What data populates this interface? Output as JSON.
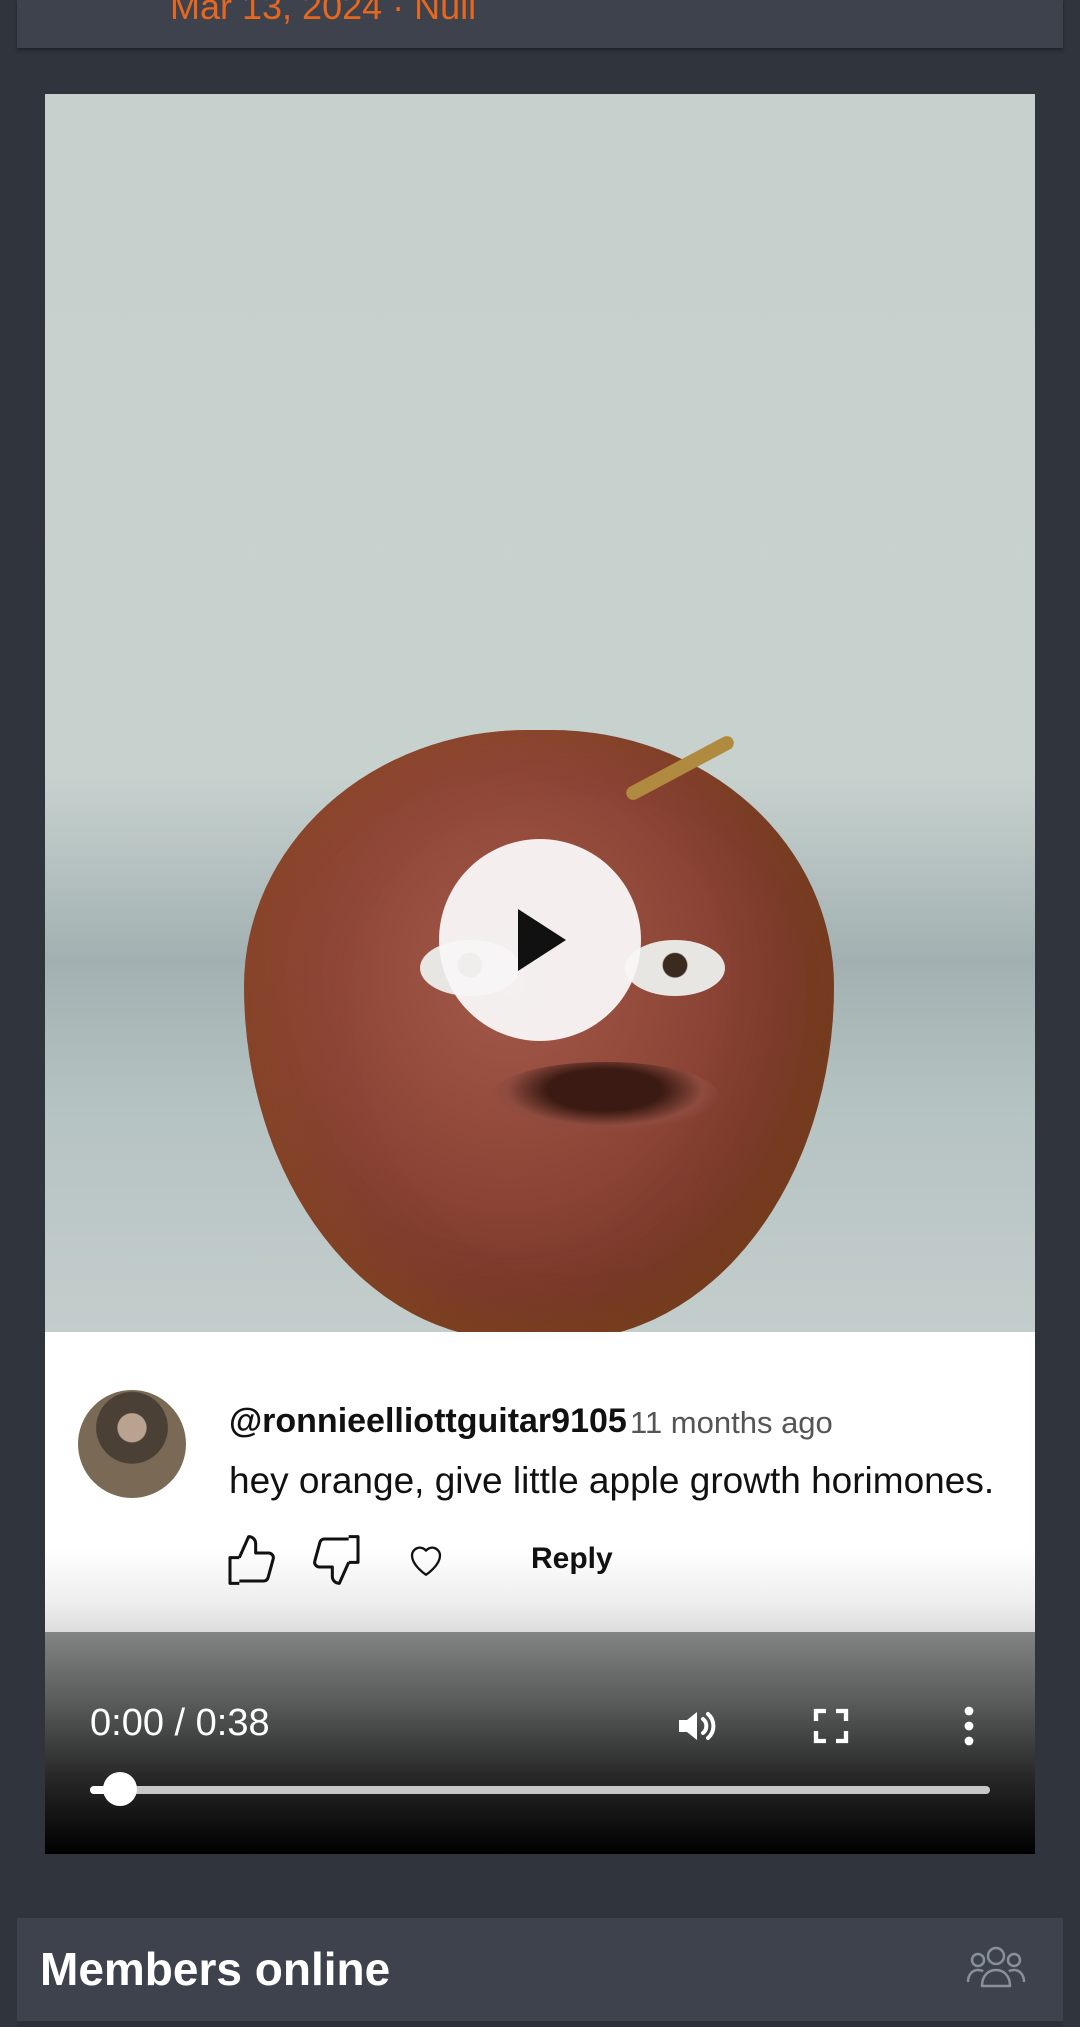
{
  "post": {
    "meta": "Mar 13, 2024 · Null"
  },
  "video": {
    "comment": {
      "username": "@ronnieelliottguitar9105",
      "time": "11 months ago",
      "text": "hey orange, give little apple growth horimones.",
      "reply_label": "Reply"
    },
    "controls": {
      "timecode": "0:00 / 0:38",
      "progress": 0.02
    }
  },
  "members": {
    "title": "Members online"
  },
  "colors": {
    "accent": "#e8671f",
    "page_bg": "#2f343d",
    "card_bg": "#3d424c"
  }
}
